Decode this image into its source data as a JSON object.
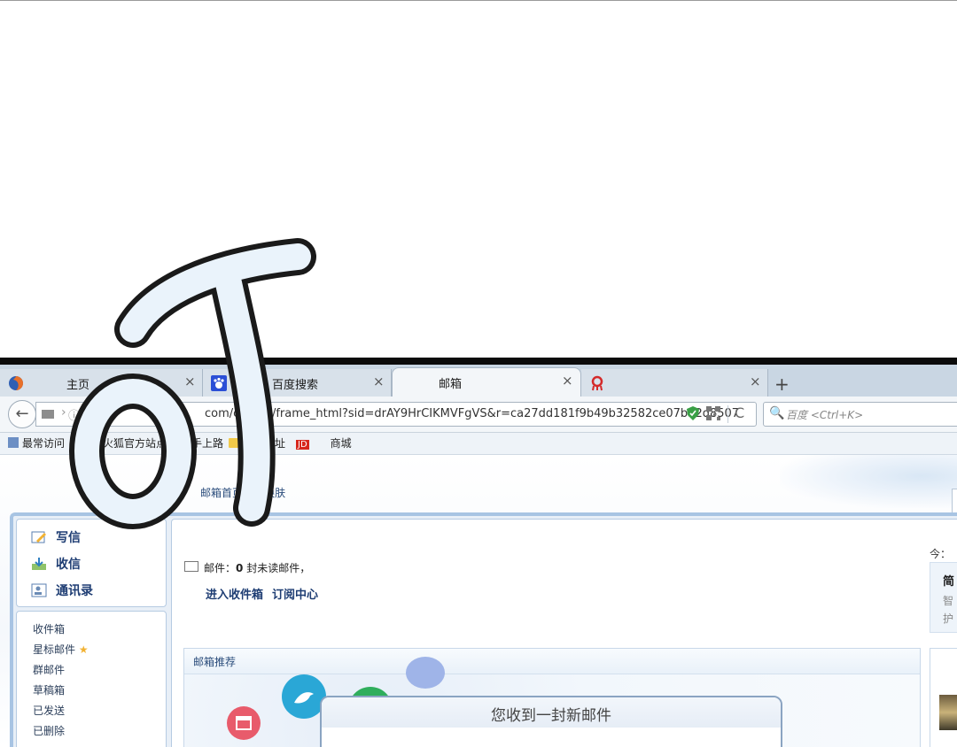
{
  "tabs": [
    {
      "label": "主页",
      "close": "×"
    },
    {
      "label": "百度搜索",
      "close": "×"
    },
    {
      "label": "邮箱",
      "close": "×"
    },
    {
      "label": "",
      "close": "×"
    }
  ],
  "new_tab": "+",
  "nav": {
    "back": "←",
    "url": "com/cgi-bin/frame_html?sid=drAY9HrCIKMVFgVS&r=ca27dd181f9b49b32582ce07b52d8507",
    "reload": "C",
    "search_placeholder": "百度 <Ctrl+K>",
    "search_icon": "🔍"
  },
  "bookmarks": [
    "最常访问",
    "火狐官方站点",
    "新手上路",
    "常用网址",
    "商城"
  ],
  "bookmark_badge": "JD",
  "topnav": [
    "邮箱首页",
    "|",
    "换肤"
  ],
  "actions": [
    "写信",
    "收信",
    "通讯录"
  ],
  "folders": [
    "收件箱",
    "星标邮件",
    "群邮件",
    "草稿箱",
    "已发送",
    "已删除"
  ],
  "star": "★",
  "mail_status": {
    "prefix": "邮件：",
    "count": "0",
    "suffix": " 封未读邮件，"
  },
  "mail_links": [
    "进入收件箱",
    "订阅中心"
  ],
  "reco_title": "邮箱推荐",
  "side": {
    "today": "今：",
    "title": "简",
    "line1": "智",
    "line2": "护"
  },
  "popup_title": "您收到一封新邮件",
  "colors": {
    "accent": "#1e3d73",
    "frame": "#a8c4e3",
    "bubble_blue": "#2aa7d6",
    "bubble_red": "#e85b6b",
    "bubble_green": "#2fae5c"
  }
}
